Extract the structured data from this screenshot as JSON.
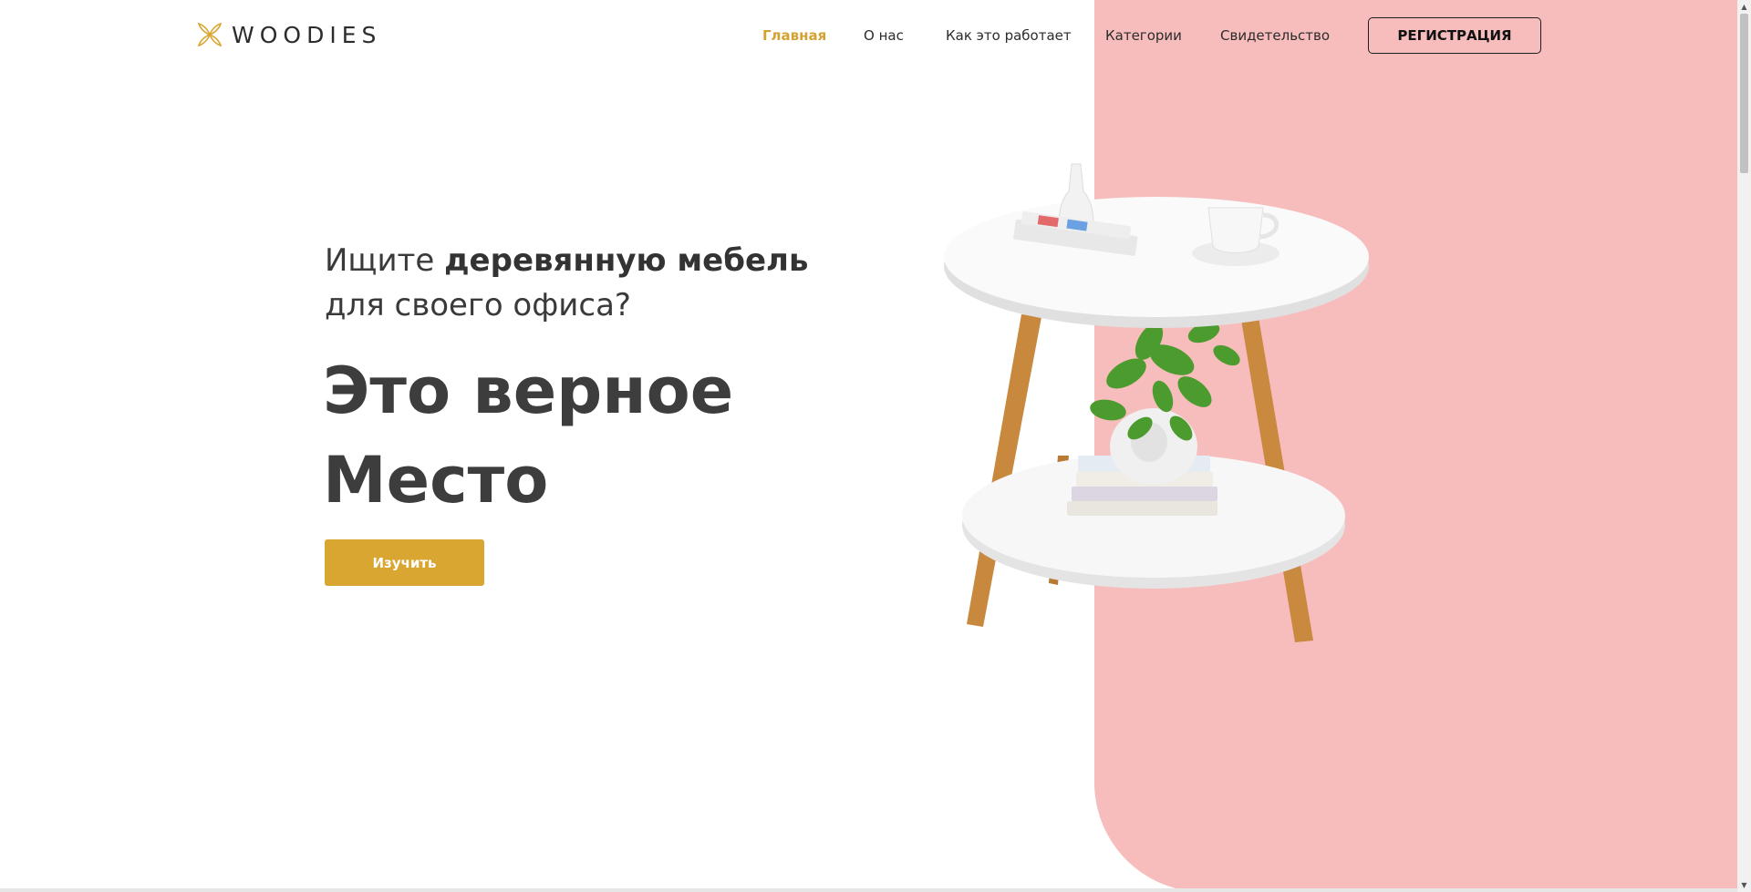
{
  "brand": {
    "name": "WOODIES",
    "accent_color": "#d9a632",
    "panel_color": "#f7bcbc"
  },
  "nav": {
    "items": [
      {
        "label": "Главная",
        "active": true
      },
      {
        "label": "О нас",
        "active": false
      },
      {
        "label": "Как это работает",
        "active": false
      },
      {
        "label": "Категории",
        "active": false
      },
      {
        "label": "Свидетельство",
        "active": false
      }
    ],
    "register_label": "РЕГИСТРАЦИЯ"
  },
  "hero": {
    "subtitle_prefix": "Ищите ",
    "subtitle_bold": "деревянную мебель",
    "subtitle_suffix": " для своего офиса?",
    "title_line1": "Это верное",
    "title_line2": "Место",
    "cta_label": "Изучить",
    "image": "side-table-with-plant-and-books"
  }
}
